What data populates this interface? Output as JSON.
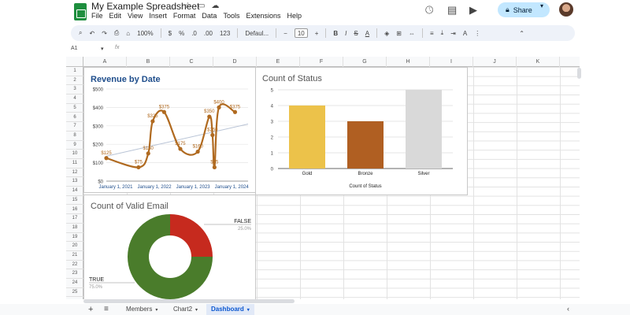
{
  "document": {
    "title": "My Example Spreadsheet"
  },
  "menu": [
    "File",
    "Edit",
    "View",
    "Insert",
    "Format",
    "Data",
    "Tools",
    "Extensions",
    "Help"
  ],
  "share": {
    "label": "Share"
  },
  "toolbar": {
    "zoom": "100%",
    "currency": "$",
    "percent": "%",
    "decimals_dec": ".0",
    "decimals_inc": ".00",
    "number_format": "123",
    "font": "Defaul...",
    "font_size": "10",
    "minus": "−",
    "plus": "+",
    "bold": "B",
    "italic": "I",
    "strike": "S",
    "text_color": "A"
  },
  "formula_bar": {
    "cell": "A1",
    "fx": "fx"
  },
  "columns": [
    "A",
    "B",
    "C",
    "D",
    "E",
    "F",
    "G",
    "H",
    "I",
    "J",
    "K"
  ],
  "rows": [
    "1",
    "2",
    "3",
    "4",
    "5",
    "6",
    "7",
    "8",
    "9",
    "10",
    "11",
    "12",
    "13",
    "14",
    "15",
    "16",
    "17",
    "18",
    "19",
    "20",
    "21",
    "22",
    "23",
    "24",
    "25"
  ],
  "sheets": [
    {
      "name": "Members",
      "active": false
    },
    {
      "name": "Chart2",
      "active": false
    },
    {
      "name": "Dashboard",
      "active": true
    }
  ],
  "colors": {
    "accent": "#0b57d0",
    "line": "#b06a20",
    "gold": "#ecc24a",
    "bronze": "#b05f22",
    "silver": "#d9d9d9",
    "donut_true": "#4a7c2b",
    "donut_false": "#c62a1e",
    "title_blue": "#1f4e8c"
  },
  "chart_data": [
    {
      "type": "line",
      "title": "Revenue by Date",
      "x_ticks": [
        "January 1, 2021",
        "January 1, 2022",
        "January 1, 2023",
        "January 1, 2024"
      ],
      "y_ticks": [
        "$0",
        "$100",
        "$200",
        "$300",
        "$400",
        "$500"
      ],
      "ylim": [
        0,
        500
      ],
      "x_domain": [
        "2021-01-01",
        "2024-09-01"
      ],
      "series": [
        {
          "points": [
            {
              "x": "2021-01-01",
              "y": 125,
              "label": "$125"
            },
            {
              "x": "2021-11-01",
              "y": 75,
              "label": "$75"
            },
            {
              "x": "2022-02-01",
              "y": 150,
              "label": "$150"
            },
            {
              "x": "2022-03-15",
              "y": 325,
              "label": "$325"
            },
            {
              "x": "2022-07-01",
              "y": 375,
              "label": "$375"
            },
            {
              "x": "2022-12-01",
              "y": 175,
              "label": "$175"
            },
            {
              "x": "2023-05-15",
              "y": 160,
              "label": "$160"
            },
            {
              "x": "2023-09-01",
              "y": 350,
              "label": "$350"
            },
            {
              "x": "2023-10-01",
              "y": 250,
              "label": "$250"
            },
            {
              "x": "2023-10-20",
              "y": 75,
              "label": "$75"
            },
            {
              "x": "2023-12-01",
              "y": 400,
              "label": "$400"
            },
            {
              "x": "2024-05-01",
              "y": 375,
              "label": "$375"
            }
          ]
        }
      ],
      "trendline": {
        "from": [
          "2021-01-01",
          135
        ],
        "to": [
          "2024-09-01",
          310
        ]
      }
    },
    {
      "type": "bar",
      "title": "Count of Status",
      "categories": [
        "Gold",
        "Bronze",
        "Silver"
      ],
      "values": [
        4,
        3,
        5
      ],
      "xlabel": "Count of Status",
      "ylim": [
        0,
        5
      ],
      "y_ticks": [
        "0",
        "1",
        "2",
        "3",
        "4",
        "5"
      ]
    },
    {
      "type": "pie",
      "title": "Count of Valid Email",
      "donut": true,
      "slices": [
        {
          "label": "FALSE",
          "value": 25,
          "pct_label": "25.0%"
        },
        {
          "label": "TRUE",
          "value": 75,
          "pct_label": "75.0%"
        }
      ]
    }
  ]
}
